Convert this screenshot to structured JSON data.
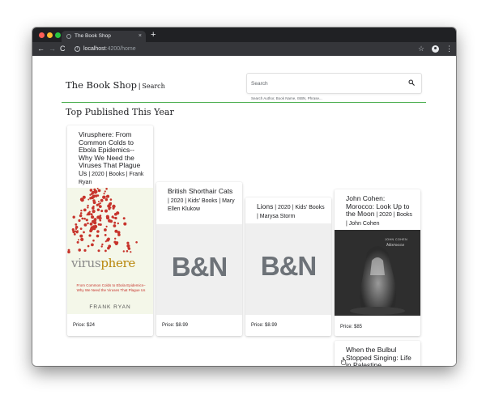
{
  "browser": {
    "tab_title": "The Book Shop",
    "new_tab_label": "+",
    "tab_close_label": "×",
    "url_host": "localhost",
    "url_path": ":4200/home",
    "back_label": "←",
    "forward_label": "→",
    "reload_label": "C",
    "info_label": "i",
    "star_label": "☆",
    "menu_label": "⋮"
  },
  "header": {
    "brand_title": "The Book Shop",
    "brand_separator": "|",
    "brand_search_label": "Search",
    "search_placeholder": "Search",
    "search_hint": "Search Author, Book Name, ISBN, Phrase..."
  },
  "section": {
    "title": "Top Published This Year"
  },
  "books": [
    {
      "title": "Virusphere: From Common Colds to Ebola Epidemics--Why We Need the Viruses That Plague Us",
      "meta": " | 2020 | Books | Frank Ryan",
      "price": "Price: $24",
      "cover": "virusphere-cover",
      "cover_text": {
        "word_main": "virus",
        "word_accent": "phere",
        "subtitle": "From Common Colds to Ebola Epidemics– Why We Need the Viruses That Plague Us",
        "author": "FRANK RYAN"
      }
    },
    {
      "title": "British Shorthair Cats",
      "meta": " | 2020 | Kids' Books | Mary Ellen Klukow",
      "price": "Price: $8.99",
      "cover": "bn-placeholder",
      "cover_text": {
        "logo": "B&N"
      }
    },
    {
      "title": "Lions",
      "meta": " | 2020 | Kids' Books | Marysa Storm",
      "price": "Price: $8.99",
      "cover": "bn-placeholder",
      "cover_text": {
        "logo": "B&N"
      }
    },
    {
      "title": "John Cohen: Morocco: Look Up to the Moon",
      "meta": " | 2020 | Books | John Cohen",
      "price": "Price: $85",
      "cover": "morocco-photo",
      "cover_text": {
        "author": "JOHN COHEN",
        "title": "Morocco"
      }
    },
    {
      "title": "When the Bulbul Stopped Singing: Life in Palestine",
      "meta": "",
      "price": "",
      "cover": "none"
    }
  ],
  "colors": {
    "accent_divider": "#4caf50",
    "chrome_dark": "#202124",
    "toolbar": "#35363a",
    "virus_dots": "#c7342c"
  }
}
